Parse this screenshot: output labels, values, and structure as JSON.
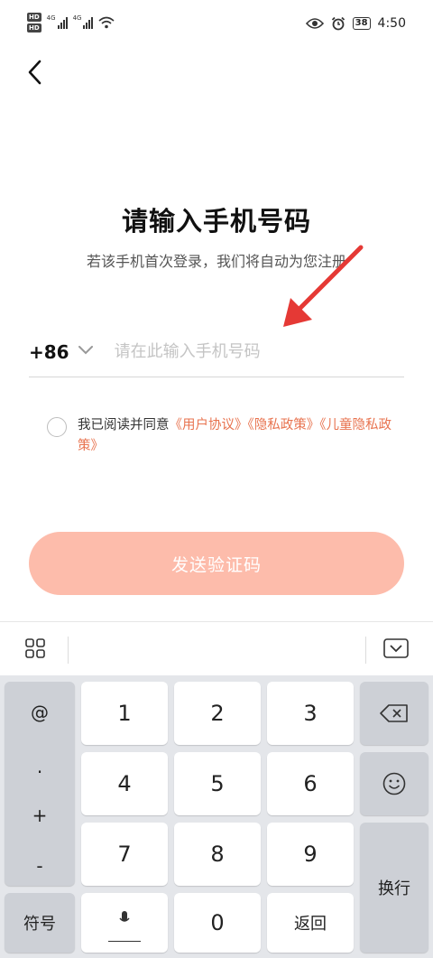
{
  "status": {
    "time": "4:50",
    "battery": "38",
    "network_a": "4G",
    "network_b": "4G",
    "hd_a": "HD",
    "hd_b": "HD"
  },
  "screen": {
    "title": "请输入手机号码",
    "subtitle": "若该手机首次登录，我们将自动为您注册",
    "country_code": "+86",
    "phone_placeholder": "请在此输入手机号码",
    "phone_value": "",
    "agreement_prefix": "我已阅读并同意",
    "link_user": "《用户协议》",
    "link_privacy": "《隐私政策》",
    "link_child": "《儿童隐私政策》",
    "send_button": "发送验证码"
  },
  "keyboard": {
    "symbols": [
      "@",
      ".",
      "+",
      "-"
    ],
    "keys": [
      "1",
      "2",
      "3",
      "4",
      "5",
      "6",
      "7",
      "8",
      "9",
      "0"
    ],
    "sym_key": "符号",
    "back_key": "返回",
    "enter_key": "换行"
  },
  "colors": {
    "accent": "#e8734f",
    "button_disabled": "#fdbcab",
    "arrow": "#e53935"
  }
}
